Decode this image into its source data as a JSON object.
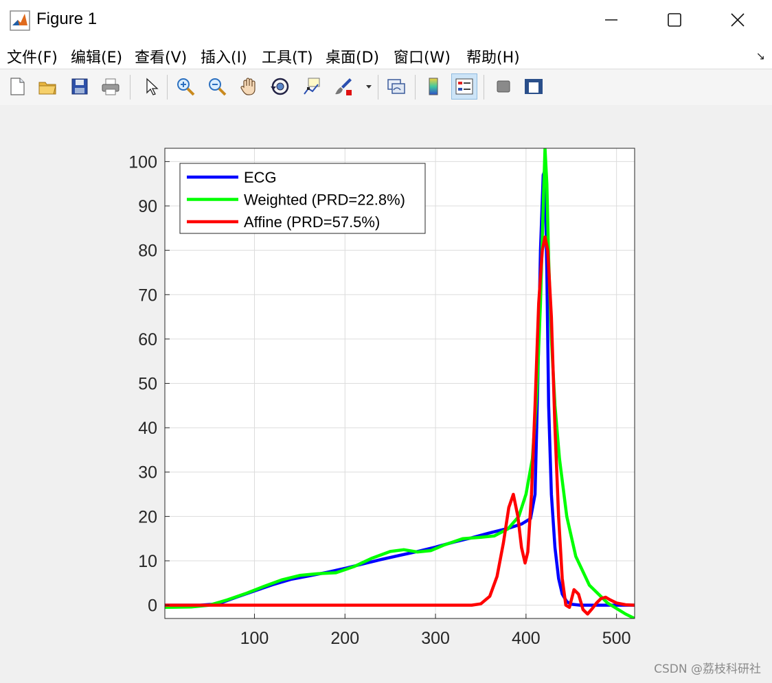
{
  "window": {
    "title": "Figure 1",
    "minimize_icon": "minimize-icon",
    "maximize_icon": "maximize-icon",
    "close_icon": "close-icon"
  },
  "menu": {
    "items": [
      "文件(F)",
      "编辑(E)",
      "查看(V)",
      "插入(I)",
      "工具(T)",
      "桌面(D)",
      "窗口(W)",
      "帮助(H)"
    ],
    "corner_icon": "dock-arrow-icon"
  },
  "toolbar": {
    "buttons": [
      "new-figure-icon",
      "open-file-icon",
      "save-icon",
      "print-icon",
      "edit-plot-arrow-icon",
      "zoom-in-icon",
      "zoom-out-icon",
      "pan-hand-icon",
      "rotate-3d-icon",
      "data-cursor-icon",
      "brush-icon",
      "link-plot-icon",
      "insert-colorbar-icon",
      "insert-legend-icon",
      "hide-plot-tools-icon",
      "show-plot-tools-icon"
    ],
    "active": "insert-legend-icon"
  },
  "watermark": "CSDN @荔枝科研社",
  "chart_data": {
    "type": "line",
    "title": "",
    "xlabel": "",
    "ylabel": "",
    "xlim": [
      1,
      520
    ],
    "ylim": [
      -3,
      103
    ],
    "xticks": [
      100,
      200,
      300,
      400,
      500
    ],
    "yticks": [
      0,
      10,
      20,
      30,
      40,
      50,
      60,
      70,
      80,
      90,
      100
    ],
    "grid": true,
    "legend_position": "top-left",
    "series": [
      {
        "name": "ECG",
        "color": "#0000ff",
        "x": [
          1,
          40,
          60,
          80,
          100,
          120,
          140,
          160,
          180,
          200,
          220,
          240,
          260,
          280,
          300,
          320,
          340,
          360,
          380,
          395,
          405,
          410,
          413,
          416,
          419,
          421,
          423,
          425,
          428,
          432,
          436,
          440,
          445,
          450,
          460,
          480,
          500,
          520
        ],
        "y": [
          0,
          0,
          0.3,
          1.8,
          3.2,
          4.6,
          5.8,
          6.6,
          7.4,
          8.3,
          9.3,
          10.3,
          11.2,
          12.1,
          13.1,
          14.2,
          15.2,
          16.3,
          17.3,
          18.3,
          19.5,
          25,
          50,
          80,
          97,
          98,
          75,
          45,
          25,
          13,
          6,
          2.5,
          0.8,
          0.2,
          0,
          0,
          0,
          0
        ]
      },
      {
        "name": "Weighted (PRD=22.8%)",
        "color": "#00ff00",
        "x": [
          1,
          30,
          50,
          70,
          90,
          110,
          130,
          150,
          170,
          190,
          210,
          230,
          250,
          265,
          280,
          295,
          310,
          330,
          350,
          365,
          380,
          392,
          400,
          407,
          412,
          416,
          419,
          421,
          423,
          425,
          428,
          432,
          437,
          445,
          455,
          470,
          490,
          510,
          520
        ],
        "y": [
          -0.5,
          -0.4,
          0,
          1.2,
          2.6,
          4.2,
          5.7,
          6.7,
          7.1,
          7.3,
          8.7,
          10.6,
          12.1,
          12.5,
          12.0,
          12.3,
          13.6,
          15.0,
          15.3,
          15.6,
          17.2,
          20,
          25,
          33,
          48,
          68,
          90,
          103,
          95,
          78,
          60,
          45,
          33,
          20,
          11,
          4.5,
          0.5,
          -2,
          -3
        ]
      },
      {
        "name": "Affine (PRD=57.5%)",
        "color": "#ff0000",
        "x": [
          1,
          100,
          200,
          300,
          340,
          350,
          360,
          368,
          375,
          381,
          386,
          391,
          395,
          399,
          402,
          406,
          410,
          414,
          418,
          421,
          424,
          428,
          432,
          436,
          440,
          444,
          448,
          453,
          458,
          463,
          468,
          473,
          478,
          483,
          488,
          493,
          500,
          510,
          520
        ],
        "y": [
          0,
          0,
          0,
          0,
          0,
          0.3,
          2,
          6.5,
          14,
          22,
          25,
          20,
          13,
          9.5,
          12,
          25,
          45,
          68,
          80,
          83,
          80,
          65,
          40,
          20,
          6,
          0,
          -0.5,
          3.5,
          2.5,
          -1,
          -2,
          -0.8,
          0.5,
          1.5,
          1.8,
          1.2,
          0.5,
          0.1,
          0
        ]
      }
    ]
  }
}
